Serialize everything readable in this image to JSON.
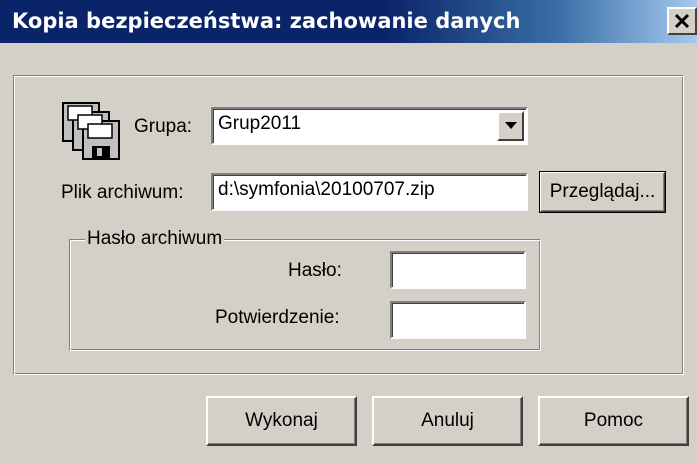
{
  "window": {
    "title": "Kopia bezpieczeństwa: zachowanie danych",
    "close_symbol": "✕",
    "close_icon": "close-icon"
  },
  "form": {
    "group_label": "Grupa:",
    "group_value": "Grup2011",
    "archive_label": "Plik archiwum:",
    "archive_value": "d:\\symfonia\\20100707.zip",
    "browse_label": "Przeglądaj..."
  },
  "password_section": {
    "legend": "Hasło archiwum",
    "password_label": "Hasło:",
    "password_value": "",
    "confirm_label": "Potwierdzenie:",
    "confirm_value": ""
  },
  "buttons": {
    "execute": "Wykonaj",
    "cancel": "Anuluj",
    "help": "Pomoc"
  },
  "icons": {
    "backup": "floppy-disks-icon",
    "combo_arrow": "chevron-down-icon"
  },
  "colors": {
    "titlebar": "#0a246a",
    "dialog_bg": "#d4d0c8"
  }
}
